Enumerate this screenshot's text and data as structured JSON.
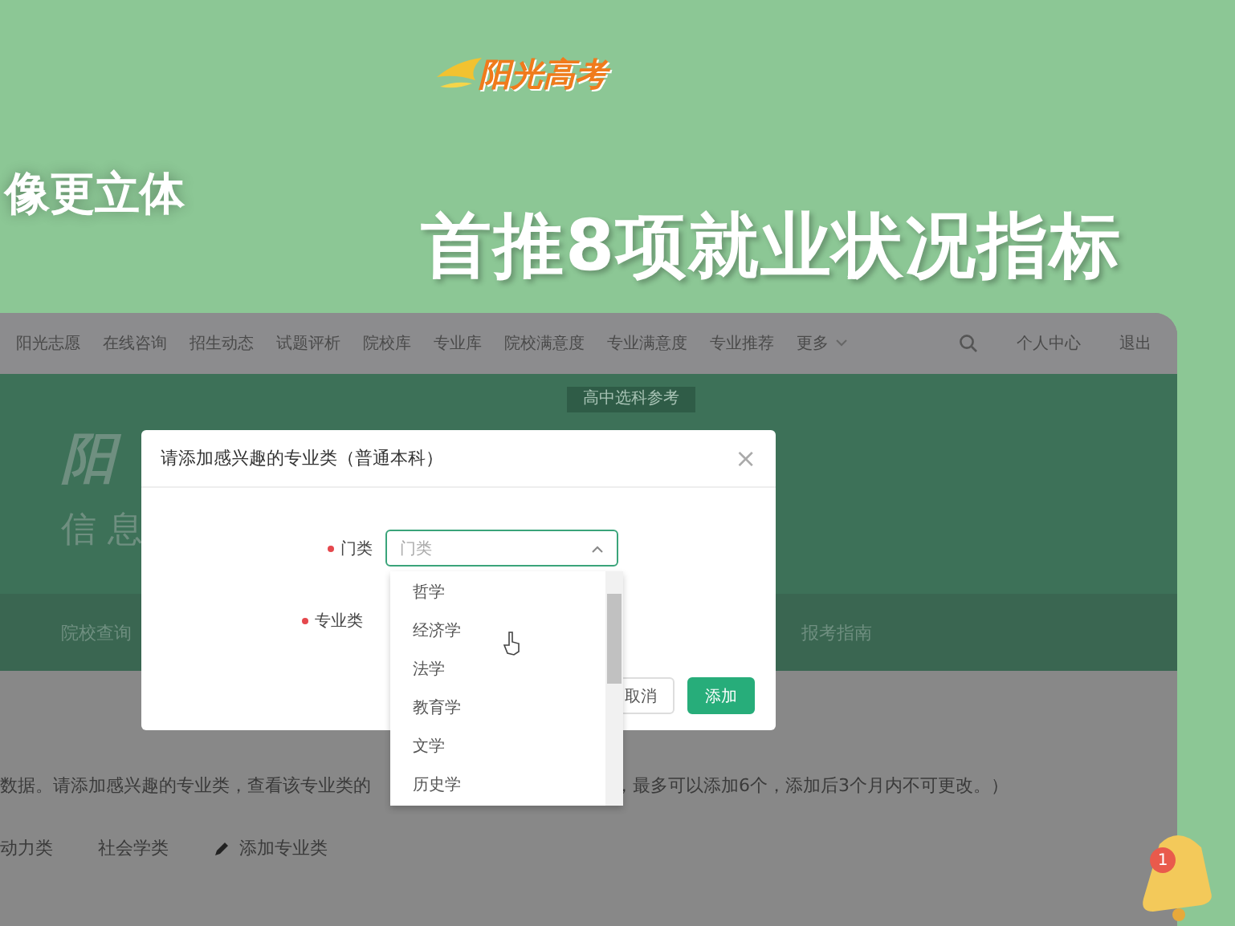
{
  "promo": {
    "logo": "阳光高考",
    "side_caption": "像更立体",
    "headline": "首推8项就业状况指标"
  },
  "nav": {
    "items": [
      "阳光志愿",
      "在线咨询",
      "招生动态",
      "试题评析",
      "院校库",
      "专业库",
      "院校满意度",
      "专业满意度",
      "专业推荐",
      "更多"
    ],
    "user": "个人中心",
    "logout": "退出"
  },
  "banner": {
    "logo_char": "阳",
    "subtitle": "信 息",
    "tag": "高中选科参考"
  },
  "subnav": [
    "院校查询",
    "报考指南"
  ],
  "notice": {
    "before": "数据。请添加感兴趣的专业类，查看该专业类的",
    "after": "，最多可以添加6个，添加后3个月内不可更改。）"
  },
  "tags": [
    {
      "label": "动力类",
      "kind": "tag"
    },
    {
      "label": "社会学类",
      "kind": "tag"
    },
    {
      "label": "添加专业类",
      "kind": "add"
    }
  ],
  "dialog": {
    "title": "请添加感兴趣的专业类（普通本科）",
    "close": "×",
    "fields": [
      {
        "label": "门类",
        "required": true,
        "placeholder": "门类",
        "open": true
      },
      {
        "label": "专业类",
        "required": true
      }
    ],
    "buttons": [
      {
        "label": "取消",
        "kind": "secondary"
      },
      {
        "label": "添加",
        "kind": "primary"
      }
    ]
  },
  "dropdown": {
    "options": [
      "哲学",
      "经济学",
      "法学",
      "教育学",
      "文学",
      "历史学"
    ]
  },
  "bell": {
    "badge": "1"
  }
}
